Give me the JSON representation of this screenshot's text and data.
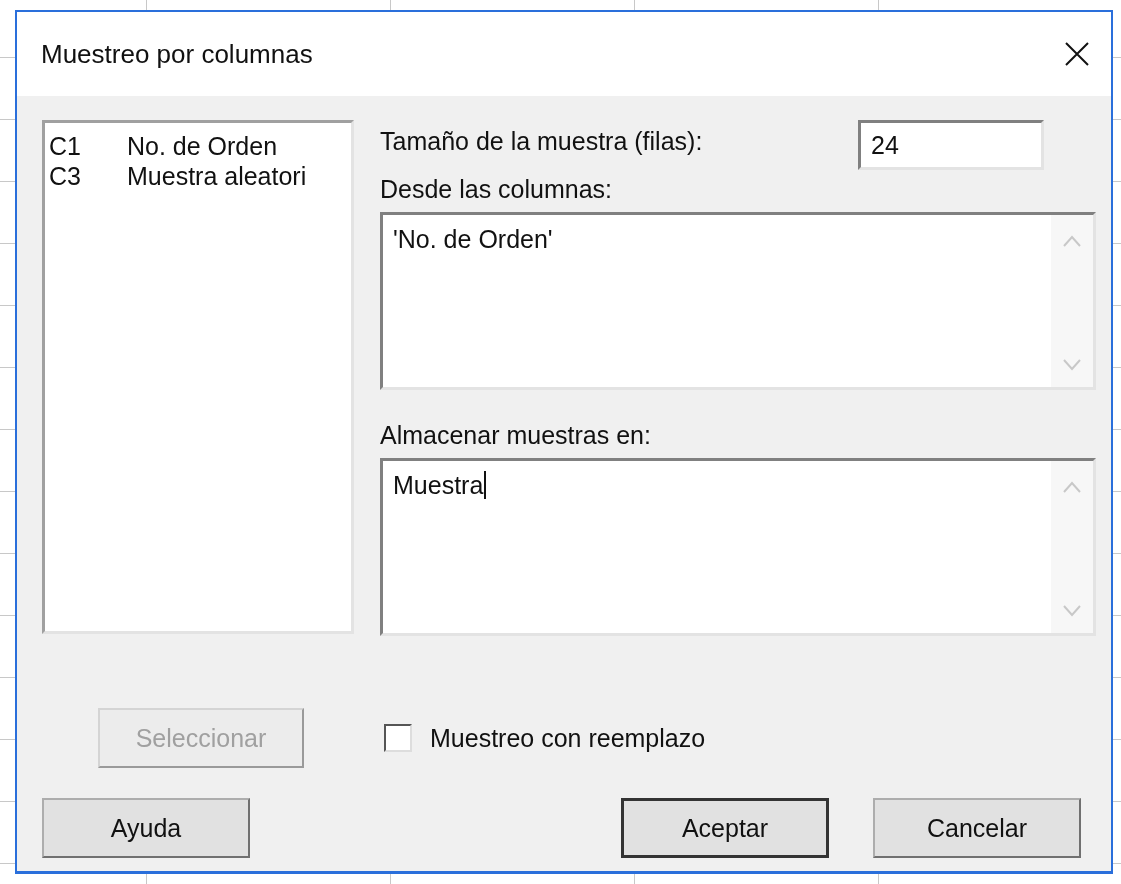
{
  "window": {
    "title": "Muestreo por columnas"
  },
  "columns_list": {
    "items": [
      {
        "id_label": "C1",
        "name": "No. de Orden",
        "selected": false
      },
      {
        "id_label": "C3",
        "name": "Muestra aleatori",
        "selected": false
      }
    ]
  },
  "sample_size": {
    "label": "Tamaño de la muestra (filas):",
    "value": "24"
  },
  "from_columns": {
    "label": "Desde las columnas:",
    "value": "'No. de Orden'"
  },
  "store_in": {
    "label": "Almacenar muestras en:",
    "value": "Muestra",
    "focused": true
  },
  "select_button": {
    "label": "Seleccionar",
    "disabled": true
  },
  "replacement": {
    "label": "Muestreo con reemplazo",
    "checked": false
  },
  "buttons": [
    {
      "label": "Ayuda",
      "default": false
    },
    {
      "label": "Aceptar",
      "default": true
    },
    {
      "label": "Cancelar",
      "default": false
    }
  ]
}
